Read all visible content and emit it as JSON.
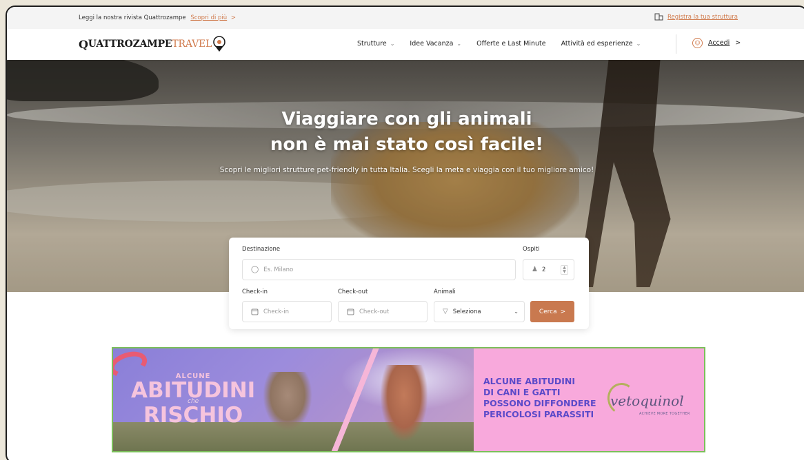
{
  "topbar": {
    "promo_text": "Leggi la nostra rivista Quattrozampe",
    "promo_link": "Scopri di più",
    "promo_arrow": ">",
    "register_icon": "building-icon",
    "register_label": "Registra la tua struttura"
  },
  "nav": {
    "logo_part1": "Q",
    "logo_part2": "UATTROZAMPE",
    "logo_part3": "TRAVEL",
    "logo_icon": "map-pin-icon",
    "items": [
      {
        "label": "Strutture",
        "has_dropdown": true
      },
      {
        "label": "Idee Vacanza",
        "has_dropdown": true
      },
      {
        "label": "Offerte e Last Minute",
        "has_dropdown": false
      },
      {
        "label": "Attività ed esperienze",
        "has_dropdown": true
      }
    ],
    "dropdown_glyph": "⌄",
    "login_icon": "user-icon",
    "login_label": "Accedi",
    "login_arrow": ">"
  },
  "hero": {
    "title_line1": "Viaggiare con gli animali",
    "title_line2": "non è mai stato così facile!",
    "subtitle": "Scopri le migliori strutture pet-friendly in tutta Italia. Scegli la meta e viaggia con il tuo migliore amico!"
  },
  "search": {
    "destination_label": "Destinazione",
    "destination_placeholder": "Es. Milano",
    "destination_icon": "location-icon",
    "guests_label": "Ospiti",
    "guests_value": "2",
    "guests_icon": "people-icon",
    "checkin_label": "Check-in",
    "checkin_placeholder": "Check-in",
    "checkout_label": "Check-out",
    "checkout_placeholder": "Check-out",
    "calendar_icon": "calendar-icon",
    "animals_label": "Animali",
    "animals_value": "Seleziona",
    "animals_icon": "paw-icon",
    "submit_label": "Cerca",
    "submit_arrow": ">"
  },
  "banner": {
    "left_line1": "ALCUNE",
    "left_line2": "ABITUDINI",
    "left_line3": "che",
    "left_line4": "RISCHIO",
    "right_text": [
      "ALCUNE ABITUDINI",
      "DI CANI E GATTI",
      "POSSONO DIFFONDERE",
      "PERICOLOSI PARASSITI"
    ],
    "brand_name": "vetoquinol",
    "brand_tagline": "ACHIEVE MORE TOGETHER"
  },
  "colors": {
    "accent": "#c9794f",
    "link": "#d07a4c",
    "banner_border": "#7bbf5a",
    "banner_pink": "#f8a9dc",
    "banner_purple": "#5b4ac9"
  }
}
